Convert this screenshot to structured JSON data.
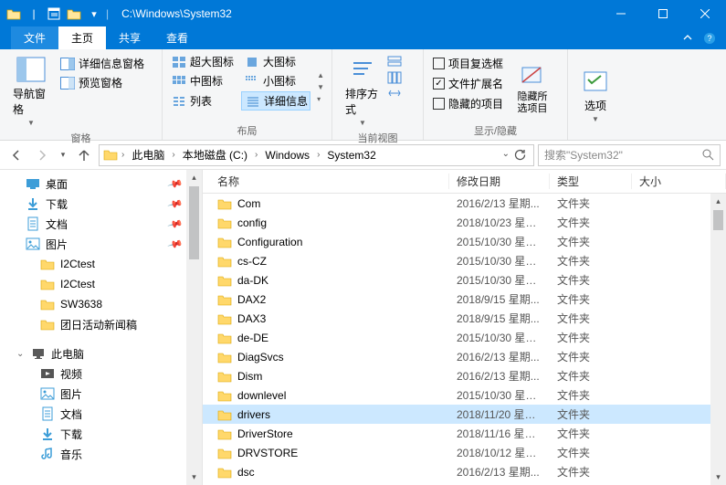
{
  "titlebar": {
    "title": "C:\\Windows\\System32"
  },
  "tabs": {
    "file": "文件",
    "home": "主页",
    "share": "共享",
    "view": "查看"
  },
  "ribbon": {
    "panes": {
      "nav_pane": "导航窗格",
      "preview_pane": "预览窗格",
      "details_pane": "详细信息窗格",
      "group_label": "窗格"
    },
    "layout": {
      "extra_large": "超大图标",
      "large": "大图标",
      "medium": "中图标",
      "small": "小图标",
      "list": "列表",
      "details": "详细信息",
      "group_label": "布局"
    },
    "current_view": {
      "sort": "排序方式",
      "group_label": "当前视图"
    },
    "show_hide": {
      "item_checkboxes": "项目复选框",
      "file_ext": "文件扩展名",
      "hidden_items": "隐藏的项目",
      "hide_selected": "隐藏所选项目",
      "group_label": "显示/隐藏"
    },
    "options": {
      "label": "选项"
    }
  },
  "address": {
    "this_pc": "此电脑",
    "drive": "本地磁盘 (C:)",
    "windows": "Windows",
    "system32": "System32"
  },
  "search": {
    "placeholder": "搜索\"System32\""
  },
  "sidebar": {
    "quick": [
      {
        "icon": "desktop",
        "label": "桌面",
        "pinned": true
      },
      {
        "icon": "download",
        "label": "下载",
        "pinned": true
      },
      {
        "icon": "document",
        "label": "文档",
        "pinned": true
      },
      {
        "icon": "picture",
        "label": "图片",
        "pinned": true
      },
      {
        "icon": "folder",
        "label": "I2Ctest",
        "pinned": false,
        "indent": true
      },
      {
        "icon": "folder",
        "label": "I2Ctest",
        "pinned": false,
        "indent": true
      },
      {
        "icon": "folder",
        "label": "SW3638",
        "pinned": false,
        "indent": true
      },
      {
        "icon": "folder",
        "label": "团日活动新闻稿",
        "pinned": false,
        "indent": true
      }
    ],
    "this_pc_label": "此电脑",
    "this_pc_children": [
      {
        "icon": "video",
        "label": "视频"
      },
      {
        "icon": "picture",
        "label": "图片"
      },
      {
        "icon": "document",
        "label": "文档"
      },
      {
        "icon": "download",
        "label": "下载"
      },
      {
        "icon": "music",
        "label": "音乐"
      }
    ]
  },
  "columns": {
    "name": "名称",
    "date": "修改日期",
    "type": "类型",
    "size": "大小"
  },
  "type_folder": "文件夹",
  "files": [
    {
      "name": "Com",
      "date": "2016/2/13 星期..."
    },
    {
      "name": "config",
      "date": "2018/10/23 星期..."
    },
    {
      "name": "Configuration",
      "date": "2015/10/30 星期..."
    },
    {
      "name": "cs-CZ",
      "date": "2015/10/30 星期..."
    },
    {
      "name": "da-DK",
      "date": "2015/10/30 星期..."
    },
    {
      "name": "DAX2",
      "date": "2018/9/15 星期..."
    },
    {
      "name": "DAX3",
      "date": "2018/9/15 星期..."
    },
    {
      "name": "de-DE",
      "date": "2015/10/30 星期..."
    },
    {
      "name": "DiagSvcs",
      "date": "2016/2/13 星期..."
    },
    {
      "name": "Dism",
      "date": "2016/2/13 星期..."
    },
    {
      "name": "downlevel",
      "date": "2015/10/30 星期..."
    },
    {
      "name": "drivers",
      "date": "2018/11/20 星期...",
      "selected": true
    },
    {
      "name": "DriverStore",
      "date": "2018/11/16 星期..."
    },
    {
      "name": "DRVSTORE",
      "date": "2018/10/12 星期..."
    },
    {
      "name": "dsc",
      "date": "2016/2/13 星期..."
    }
  ]
}
